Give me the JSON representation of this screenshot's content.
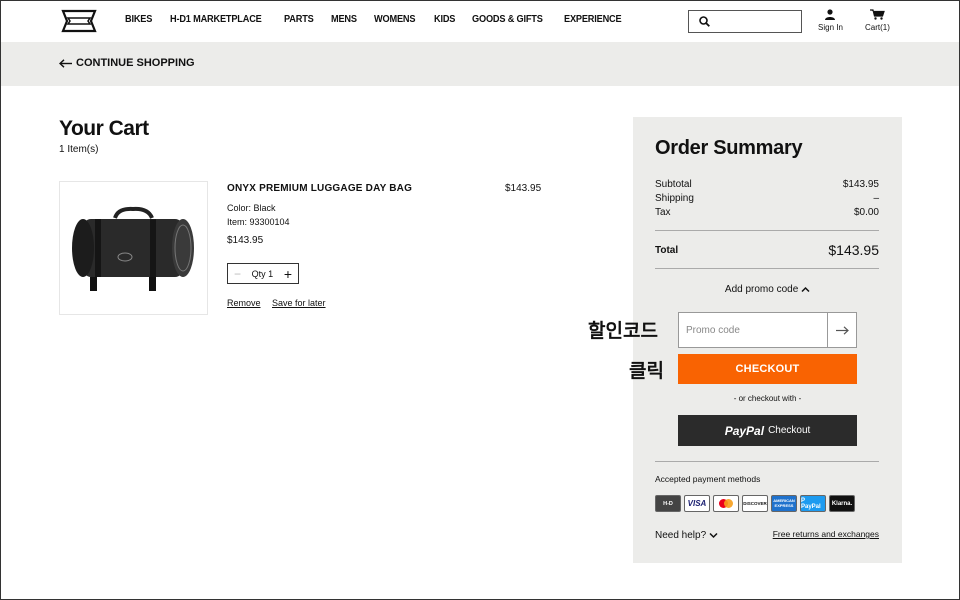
{
  "header": {
    "nav": [
      "BIKES",
      "H-D1 MARKETPLACE",
      "PARTS",
      "MENS",
      "WOMENS",
      "KIDS",
      "GOODS & GIFTS",
      "EXPERIENCE"
    ],
    "search_placeholder": "",
    "sign_in": "Sign In",
    "cart": "Cart(1)"
  },
  "continue": {
    "label": "CONTINUE SHOPPING"
  },
  "cart": {
    "title": "Your Cart",
    "count": "1 Item(s)",
    "item": {
      "name": "ONYX PREMIUM LUGGAGE DAY BAG",
      "price_right": "$143.95",
      "color": "Color: Black",
      "item_no": "Item: 93300104",
      "price": "$143.95",
      "qty_label": "Qty 1",
      "remove": "Remove",
      "save_later": "Save for later"
    }
  },
  "summary": {
    "title": "Order Summary",
    "subtotal_label": "Subtotal",
    "subtotal_value": "$143.95",
    "shipping_label": "Shipping",
    "shipping_value": "–",
    "tax_label": "Tax",
    "tax_value": "$0.00",
    "total_label": "Total",
    "total_value": "$143.95",
    "promo_toggle": "Add promo code",
    "promo_placeholder": "Promo code",
    "checkout": "CHECKOUT",
    "or_text": "- or checkout with -",
    "paypal_brand": "PayPal",
    "paypal_label": "Checkout",
    "accepted": "Accepted payment methods",
    "payment_methods": [
      "H-D",
      "VISA",
      "MC",
      "DISCOVER",
      "AMERICAN EXPRESS",
      "P PayPal",
      "Klarna."
    ],
    "need_help": "Need help?",
    "returns": "Free returns and exchanges"
  },
  "annotation": {
    "line1": "할인코드",
    "line2": "클릭"
  },
  "colors": {
    "checkout": "#f96302",
    "panel": "#ececea",
    "paypal_bg": "#2b2b2b"
  }
}
